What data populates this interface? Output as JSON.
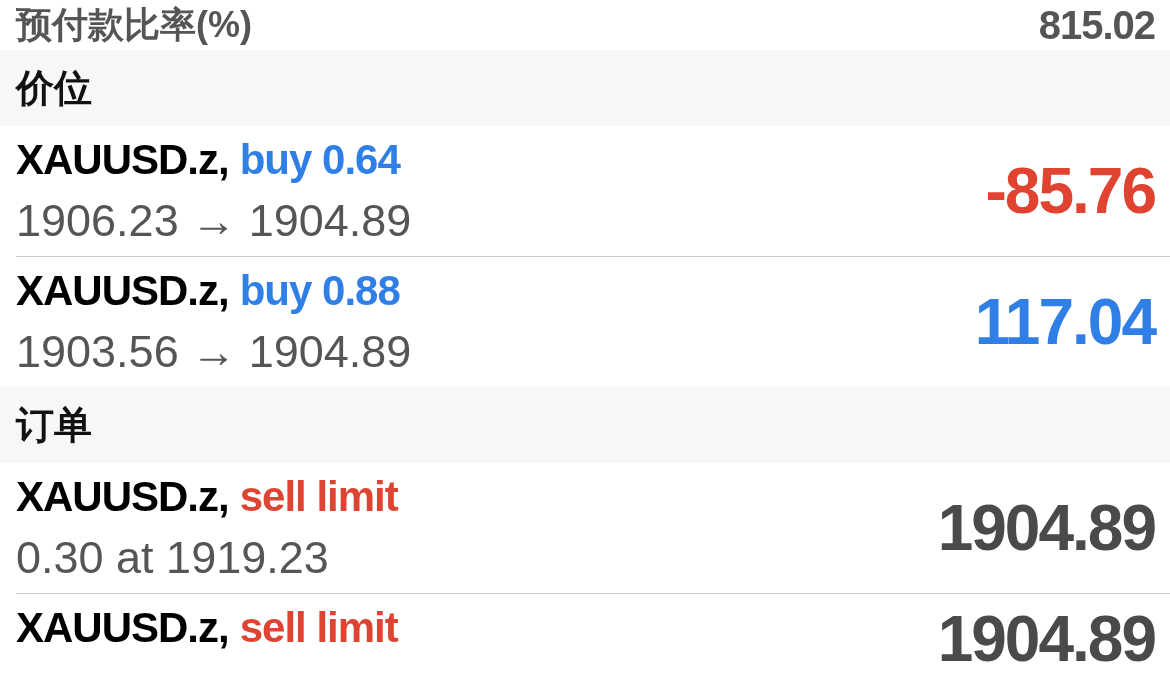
{
  "summary_row": {
    "label": "预付款比率(%)",
    "value": "815.02"
  },
  "sections": [
    {
      "title": "价位",
      "rows": [
        {
          "symbol": "XAUUSD.z,",
          "action": {
            "text": "buy 0.64",
            "color": "#2f7fe6"
          },
          "detail": "1906.23 → 1904.89",
          "value": {
            "text": "-85.76",
            "color": "#e0432f"
          }
        },
        {
          "symbol": "XAUUSD.z,",
          "action": {
            "text": "buy 0.88",
            "color": "#2f7fe6"
          },
          "detail": "1903.56 → 1904.89",
          "value": {
            "text": "117.04",
            "color": "#2f7fe6"
          }
        }
      ]
    },
    {
      "title": "订单",
      "rows": [
        {
          "symbol": "XAUUSD.z,",
          "action": {
            "text": "sell limit",
            "color": "#dd4432"
          },
          "detail": "0.30 at 1919.23",
          "value": {
            "text": "1904.89",
            "color": "#4a4a4a"
          }
        },
        {
          "symbol": "XAUUSD.z,",
          "action": {
            "text": "sell limit",
            "color": "#dd4432"
          },
          "value": {
            "text": "1904.89",
            "color": "#4a4a4a"
          }
        }
      ]
    }
  ]
}
